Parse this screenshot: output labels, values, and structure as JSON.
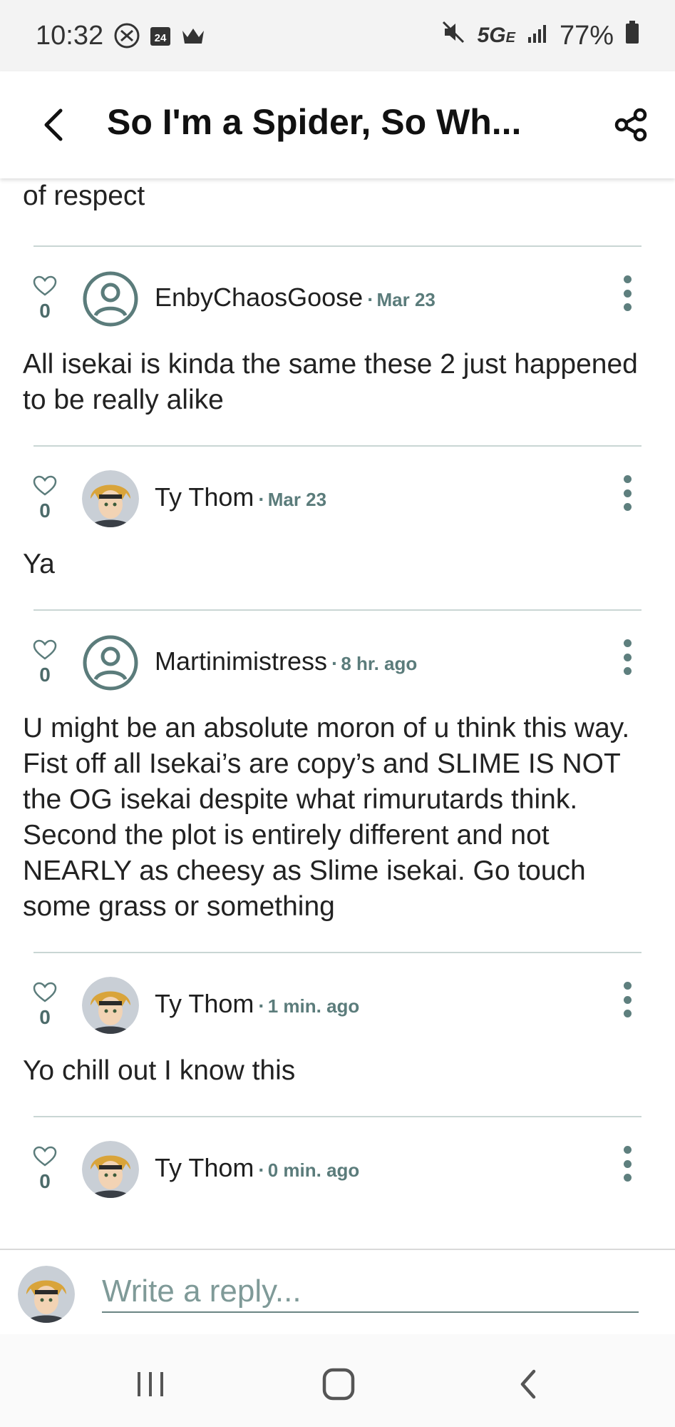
{
  "status_bar": {
    "time": "10:32",
    "calendar_day": "24",
    "network": "5G",
    "network_suffix": "E",
    "battery": "77%"
  },
  "header": {
    "title": "So I'm a Spider, So Wh..."
  },
  "thread": {
    "prev_comment_tail": "of respect",
    "comments": [
      {
        "likes": "0",
        "author": "EnbyChaosGoose",
        "date": "Mar 23",
        "avatar": "default-avatar",
        "text": "All isekai is kinda the same these 2 just happened to be really alike"
      },
      {
        "likes": "0",
        "author": "Ty Thom",
        "date": "Mar 23",
        "avatar": "anime-avatar",
        "text": "Ya"
      },
      {
        "likes": "0",
        "author": "Martinimistress",
        "date": "8 hr. ago",
        "avatar": "default-avatar",
        "text": "U might be an absolute moron of u think this way. Fist off all Isekai’s are copy’s and SLIME IS NOT the OG isekai despite what rimurutards think. Second the plot is entirely different and not NEARLY as cheesy as Slime isekai. Go touch some grass or something"
      },
      {
        "likes": "0",
        "author": "Ty Thom",
        "date": "1 min. ago",
        "avatar": "anime-avatar",
        "text": "Yo chill out I know this"
      },
      {
        "likes": "0",
        "author": "Ty Thom",
        "date": "0 min. ago",
        "avatar": "anime-avatar",
        "text": ""
      }
    ]
  },
  "reply": {
    "placeholder": "Write a reply..."
  },
  "colors": {
    "accent": "#5b7c7b",
    "divider": "#c9d6d4"
  }
}
